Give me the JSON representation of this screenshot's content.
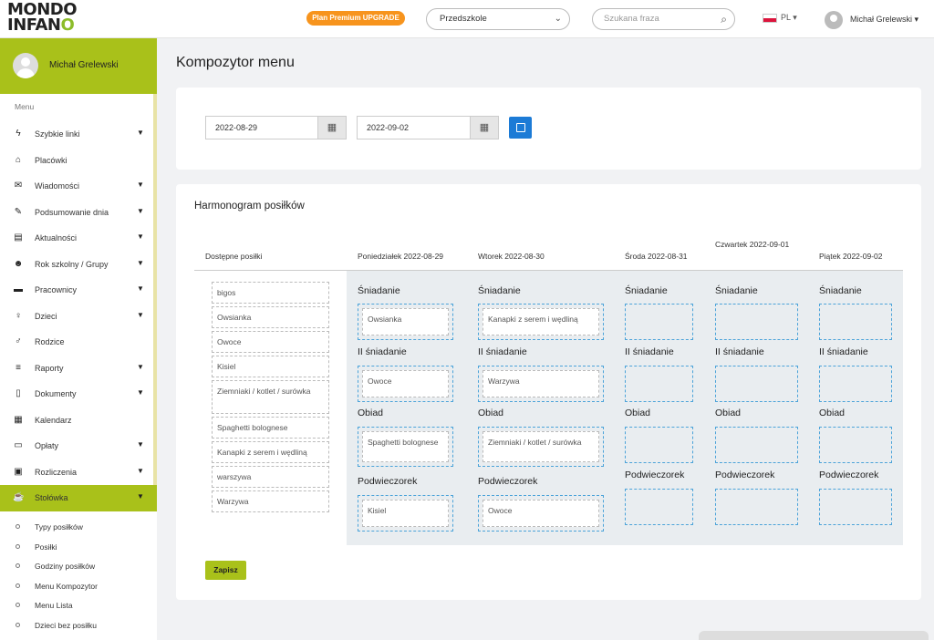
{
  "logo": {
    "line1_a": "M",
    "line1_b": "ONDO",
    "line2_a": "INFAN",
    "line2_b": "O"
  },
  "topbar": {
    "premium_label": "Plan Premium UPGRADE",
    "institution_select": "Przedszkole",
    "search_placeholder": "Szukana fraza",
    "language": "PL",
    "user_name": "Michał Grelewski"
  },
  "sidebar": {
    "user_name": "Michał Grelewski",
    "menu_title": "Menu",
    "items": [
      {
        "label": "Szybkie linki",
        "icon": "bolt-icon",
        "glyph": "ϟ",
        "chevron": true
      },
      {
        "label": "Placówki",
        "icon": "institution-icon",
        "glyph": "⌂",
        "chevron": false
      },
      {
        "label": "Wiadomości",
        "icon": "envelope-icon",
        "glyph": "✉",
        "chevron": true
      },
      {
        "label": "Podsumowanie dnia",
        "icon": "edit-icon",
        "glyph": "✎",
        "chevron": true
      },
      {
        "label": "Aktualności",
        "icon": "news-icon",
        "glyph": "▤",
        "chevron": true
      },
      {
        "label": "Rok szkolny / Grupy",
        "icon": "users-icon",
        "glyph": "☻",
        "chevron": true
      },
      {
        "label": "Pracownicy",
        "icon": "briefcase-icon",
        "glyph": "▬",
        "chevron": true
      },
      {
        "label": "Dzieci",
        "icon": "child-icon",
        "glyph": "♀",
        "chevron": true
      },
      {
        "label": "Rodzice",
        "icon": "parent-icon",
        "glyph": "♂",
        "chevron": false
      },
      {
        "label": "Raporty",
        "icon": "database-icon",
        "glyph": "≡",
        "chevron": true
      },
      {
        "label": "Dokumenty",
        "icon": "document-icon",
        "glyph": "▯",
        "chevron": true
      },
      {
        "label": "Kalendarz",
        "icon": "calendar-icon",
        "glyph": "▦",
        "chevron": false
      },
      {
        "label": "Opłaty",
        "icon": "visa-card-icon",
        "glyph": "▭",
        "chevron": true
      },
      {
        "label": "Rozliczenia",
        "icon": "money-icon",
        "glyph": "▣",
        "chevron": true
      },
      {
        "label": "Stołówka",
        "icon": "coffee-icon",
        "glyph": "☕",
        "chevron": true,
        "active": true
      }
    ],
    "subitems": [
      "Typy posiłków",
      "Posiłki",
      "Godziny posiłków",
      "Menu Kompozytor",
      "Menu Lista",
      "Dzieci bez posiłku"
    ]
  },
  "page": {
    "title": "Kompozytor menu"
  },
  "filters": {
    "date_from": "2022-08-29",
    "date_to": "2022-09-02"
  },
  "schedule": {
    "title": "Harmonogram posiłków",
    "available_header": "Dostępne posiłki",
    "available": [
      "bigos",
      "Owsianka",
      "Owoce",
      "Kisiel",
      "Ziemniaki / kotlet / surówka",
      "Spaghetti bolognese",
      "Kanapki z serem i wędliną",
      "warszywa",
      "Warzywa"
    ],
    "days": [
      {
        "header": "Poniedziałek 2022-08-29",
        "meals": [
          {
            "label": "Śniadanie",
            "item": "Owsianka"
          },
          {
            "label": "II śniadanie",
            "item": "Owoce"
          },
          {
            "label": "Obiad",
            "item": "Spaghetti bolognese"
          },
          {
            "label": "Podwieczorek",
            "item": "Kisiel"
          }
        ]
      },
      {
        "header": "Wtorek 2022-08-30",
        "meals": [
          {
            "label": "Śniadanie",
            "item": "Kanapki z serem i wędliną"
          },
          {
            "label": "II śniadanie",
            "item": "Warzywa"
          },
          {
            "label": "Obiad",
            "item": "Ziemniaki / kotlet / surówka"
          },
          {
            "label": "Podwieczorek",
            "item": "Owoce"
          }
        ]
      },
      {
        "header": "Środa 2022-08-31",
        "meals": [
          {
            "label": "Śniadanie",
            "item": ""
          },
          {
            "label": "II śniadanie",
            "item": ""
          },
          {
            "label": "Obiad",
            "item": ""
          },
          {
            "label": "Podwieczorek",
            "item": ""
          }
        ]
      },
      {
        "header": "Czwartek 2022-09-01",
        "meals": [
          {
            "label": "Śniadanie",
            "item": ""
          },
          {
            "label": "II śniadanie",
            "item": ""
          },
          {
            "label": "Obiad",
            "item": ""
          },
          {
            "label": "Podwieczorek",
            "item": ""
          }
        ]
      },
      {
        "header": "Piątek 2022-09-02",
        "meals": [
          {
            "label": "Śniadanie",
            "item": ""
          },
          {
            "label": "II śniadanie",
            "item": ""
          },
          {
            "label": "Obiad",
            "item": ""
          },
          {
            "label": "Podwieczorek",
            "item": ""
          }
        ]
      }
    ],
    "save_label": "Zapisz"
  }
}
